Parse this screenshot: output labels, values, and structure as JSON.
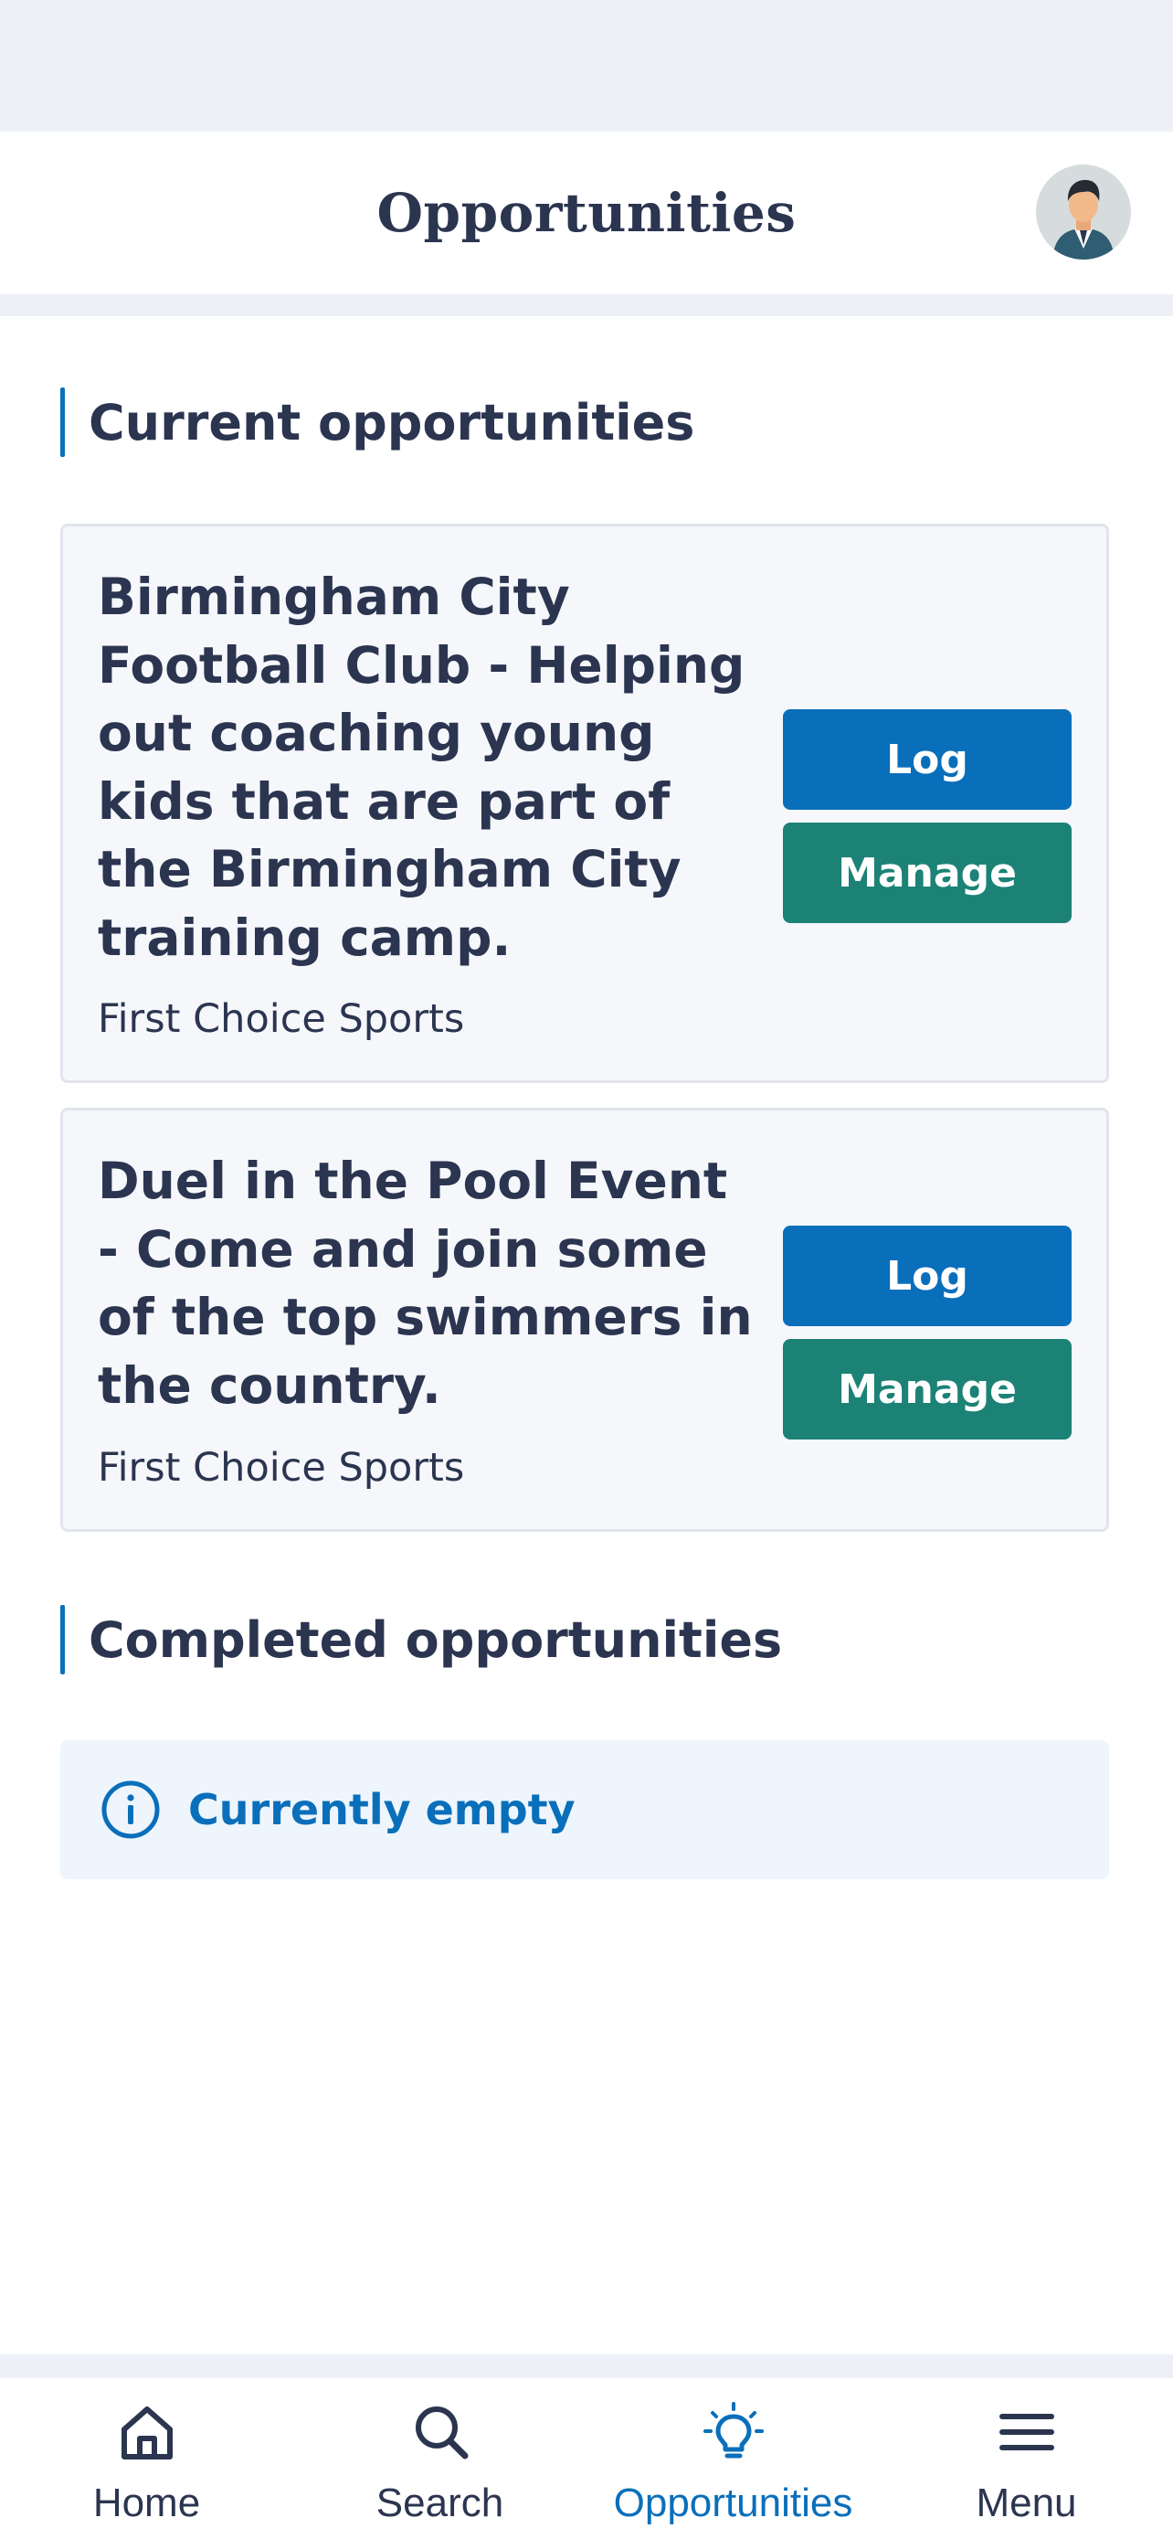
{
  "header": {
    "title": "Opportunities"
  },
  "sections": {
    "current": {
      "heading": "Current opportunities"
    },
    "completed": {
      "heading": "Completed opportunities",
      "empty_text": "Currently empty"
    }
  },
  "opportunities": [
    {
      "title": "Birmingham City Football Club - Helping out coaching young kids that are part of the Birmingham City training camp.",
      "organisation": "First Choice Sports",
      "log_label": "Log",
      "manage_label": "Manage"
    },
    {
      "title": "Duel in the Pool Event - Come and join some of the top swimmers in the country.",
      "organisation": "First Choice Sports",
      "log_label": "Log",
      "manage_label": "Manage"
    }
  ],
  "nav": {
    "items": [
      {
        "label": "Home",
        "icon": "home-icon",
        "active": false
      },
      {
        "label": "Search",
        "icon": "search-icon",
        "active": false
      },
      {
        "label": "Opportunities",
        "icon": "lightbulb-icon",
        "active": true
      },
      {
        "label": "Menu",
        "icon": "hamburger-menu-icon",
        "active": false
      }
    ]
  },
  "colors": {
    "primary": "#0a6fba",
    "secondary": "#1c8276",
    "text": "#2b3550",
    "card_bg": "#f6f7fb",
    "info_bg": "#eef5fc"
  }
}
